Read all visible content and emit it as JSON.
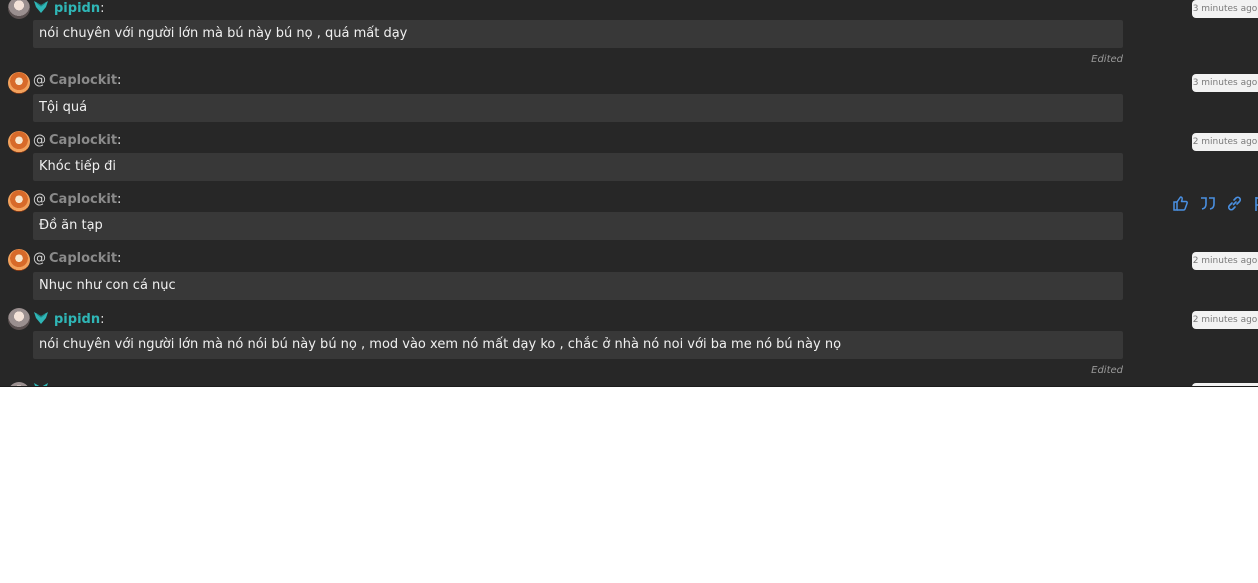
{
  "colors": {
    "panel_bg": "#272727",
    "bubble_bg": "#383838",
    "username_teal": "#2fb6b6",
    "username_gray": "#8a8a8a",
    "action_icon": "#4a90e2"
  },
  "messages": [
    {
      "author": "pipidn",
      "prefix": "",
      "suffix": ":",
      "text": "nói chuyên với người lớn mà bú này bú nọ , quá mất dạy",
      "time": "3 minutes ago",
      "edited": "Edited"
    },
    {
      "author": "Caplockit",
      "prefix": "@",
      "suffix": ":",
      "text": "Tội quá",
      "time": "3 minutes ago",
      "edited": ""
    },
    {
      "author": "Caplockit",
      "prefix": "@",
      "suffix": ":",
      "text": "Khóc tiếp đi",
      "time": "2 minutes ago",
      "edited": ""
    },
    {
      "author": "Caplockit",
      "prefix": "@",
      "suffix": ":",
      "text": "Đồ ăn tạp",
      "time": "",
      "edited": ""
    },
    {
      "author": "Caplockit",
      "prefix": "@",
      "suffix": ":",
      "text": "Nhục như con cá nục",
      "time": "2 minutes ago",
      "edited": ""
    },
    {
      "author": "pipidn",
      "prefix": "",
      "suffix": ":",
      "text": "nói chuyên với người lớn mà nó nói bú này bú nọ , mod vào xem nó mất dạy ko , chắc ở nhà nó noi với ba me nó bú này nọ",
      "time": "2 minutes ago",
      "edited": "Edited"
    }
  ],
  "actions": {
    "icons": [
      "thumbs-up-icon",
      "quote-icon",
      "link-icon",
      "flag-icon"
    ]
  }
}
